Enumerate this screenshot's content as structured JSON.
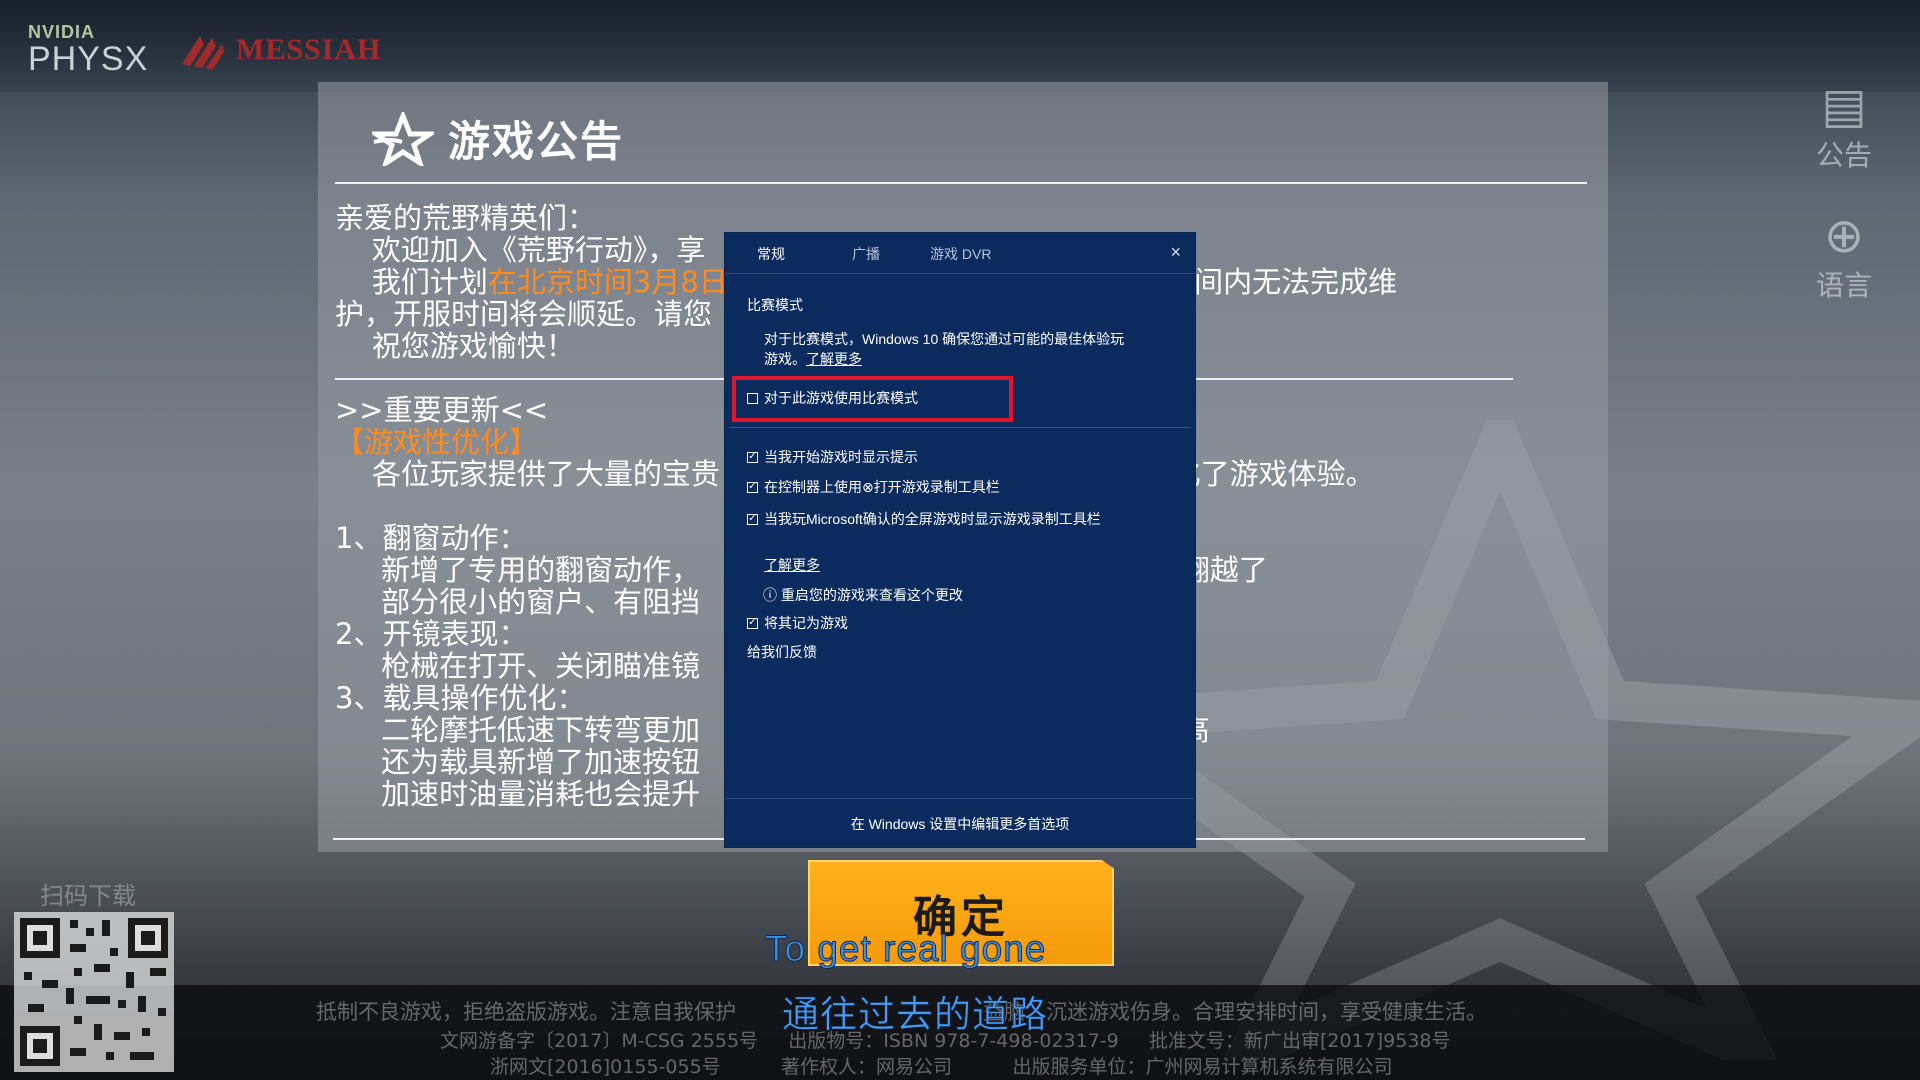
{
  "header": {
    "nvidia_label": "NVIDIA",
    "physx_label": "PHYSX",
    "messiah_label": "MESSIAH"
  },
  "side_buttons": [
    {
      "label": "公告",
      "icon": "notice-icon"
    },
    {
      "label": "语言",
      "icon": "globe-icon"
    }
  ],
  "announcement": {
    "title": "游戏公告",
    "lines": [
      {
        "pre": "亲爱的荒野精英们：",
        "hl": "",
        "post": ""
      },
      {
        "pre": "    欢迎加入《荒野行动》，享",
        "hl": "",
        "post": ""
      },
      {
        "pre": "    我们计划",
        "hl": "在北京时间3月8日",
        "post": "                                      果预定时间内无法完成维"
      },
      {
        "pre": "护，开服时间将会顺延。请您",
        "hl": "",
        "post": ""
      },
      {
        "pre": "    祝您游戏愉快！",
        "hl": "",
        "post": ""
      }
    ],
    "update_heading": ">>重要更新<<",
    "section_title": "【游戏性优化】",
    "section_lines": [
      "    各位玩家提供了大量的宝贵                                                 化了游戏体验。",
      "",
      "1、翻窗动作：",
      "     新增了专用的翻窗动作，                                                 的翻越了",
      "     部分很小的窗户、有阻挡",
      "2、开镜表现：",
      "     枪械在打开、关闭瞄准镜",
      "3、载具操作优化：",
      "     二轮摩托低速下转弯更加                                                 提高",
      "     还为载具新增了加速按钮",
      "     加速时油量消耗也会提升"
    ],
    "confirm_label": "确定"
  },
  "subtitles": {
    "line1": "To get real gone",
    "line2": "通往过去的道路"
  },
  "footer": {
    "qr_label": "扫码下载",
    "line1": "抵制不良游戏，拒绝盗版游戏。注意自我保护                                     益脑，沉迷游戏伤身。合理安排时间，享受健康生活。",
    "line2": "文网游备字〔2017〕M-CSG 2555号     出版物号：ISBN 978-7-498-02317-9     批准文号：新广出审[2017]9538号",
    "line3": "浙网文[2016]0155-055号          著作权人：网易公司          出版服务单位：广州网易计算机系统有限公司"
  },
  "dialog": {
    "tabs": [
      "常规",
      "广播",
      "游戏 DVR"
    ],
    "active_tab": "常规",
    "close_label": "×",
    "section_title": "比赛模式",
    "desc_line1": "对于比赛模式，Windows 10 确保您通过可能的最佳体验玩",
    "desc_line2": "游戏。",
    "desc_link": "了解更多",
    "game_mode_checkbox": {
      "label": "对于此游戏使用比赛模式",
      "checked": false
    },
    "options": [
      {
        "label": "当我开始游戏时显示提示",
        "checked": true
      },
      {
        "label": "在控制器上使用⊗打开游戏录制工具栏",
        "checked": true
      },
      {
        "label": "当我玩Microsoft确认的全屏游戏时显示游戏录制工具栏",
        "checked": true
      }
    ],
    "learn_more": "了解更多",
    "restart_note": "重启您的游戏来查看这个更改",
    "remember_game": {
      "label": "将其记为游戏",
      "checked": true
    },
    "feedback": "给我们反馈",
    "footer_link": "在 Windows 设置中编辑更多首选项"
  },
  "colors": {
    "dialog_bg": "#0b2a5e",
    "highlight_border": "#e0162b",
    "announcement_orange": "#ff8a1e",
    "confirm_button": "#f8a414"
  }
}
